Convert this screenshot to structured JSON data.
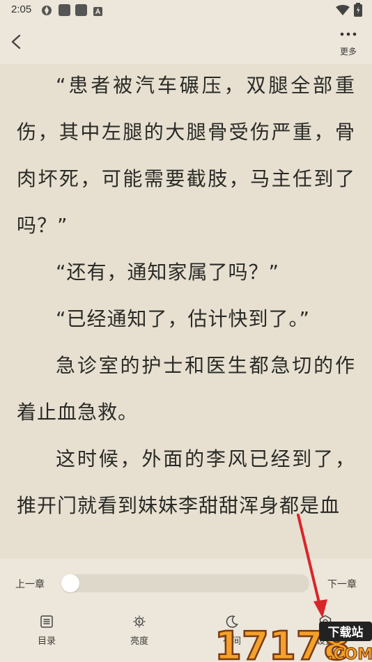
{
  "status_bar": {
    "time": "2:05"
  },
  "header": {
    "more_label": "更多"
  },
  "reader": {
    "paragraphs": [
      "“患者被汽车碾压，双腿全部重伤，其中左腿的大腿骨受伤严重，骨肉坏死，可能需要截肢，马主任到了吗？”",
      "“还有，通知家属了吗？”",
      "“已经通知了，估计快到了。”",
      "急诊室的护士和医生都急切的作着止血急救。",
      "这时候，外面的李风已经到了，推开门就看到妹妹李甜甜浑身都是血"
    ]
  },
  "chapter_nav": {
    "prev_label": "上一章",
    "next_label": "下一章",
    "progress": 0
  },
  "toolbar": {
    "toc_label": "目录",
    "brightness_label": "亮度",
    "night_label": "夜间",
    "settings_label": "设置"
  },
  "watermark": {
    "text": "17178",
    "subtext": "下载站",
    "domain": ".COM"
  },
  "colors": {
    "background": "#ece6db",
    "reading_bg": "#e7e0d1",
    "accent_arrow": "#d9252a"
  }
}
